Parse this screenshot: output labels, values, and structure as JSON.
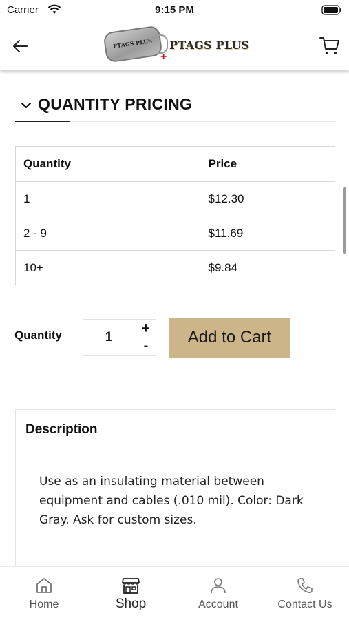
{
  "status_bar": {
    "carrier": "Carrier",
    "time": "9:15 PM"
  },
  "header": {
    "logo_text": "PTAGS PLUS",
    "logo_tag_text": "PTAGS PLUS",
    "icons": {
      "back": "arrow-left-icon",
      "cart": "cart-icon"
    }
  },
  "quantity_pricing": {
    "title": "QUANTITY PRICING",
    "columns": [
      "Quantity",
      "Price"
    ],
    "rows": [
      {
        "quantity": "1",
        "price": "$12.30"
      },
      {
        "quantity": "2 - 9",
        "price": "$11.69"
      },
      {
        "quantity": "10+",
        "price": "$9.84"
      }
    ]
  },
  "purchase": {
    "quantity_label": "Quantity",
    "quantity_value": "1",
    "plus": "+",
    "minus": "-",
    "add_to_cart": "Add to Cart",
    "accent_color": "#cdb58a"
  },
  "description": {
    "title": "Description",
    "body": "Use as an insulating material between equipment and cables (.010 mil). Color: Dark Gray. Ask for custom sizes."
  },
  "bottom_nav": {
    "items": [
      {
        "label": "Home",
        "icon": "home-icon"
      },
      {
        "label": "Shop",
        "icon": "shop-icon"
      },
      {
        "label": "Account",
        "icon": "user-icon"
      },
      {
        "label": "Contact Us",
        "icon": "phone-icon"
      }
    ]
  }
}
